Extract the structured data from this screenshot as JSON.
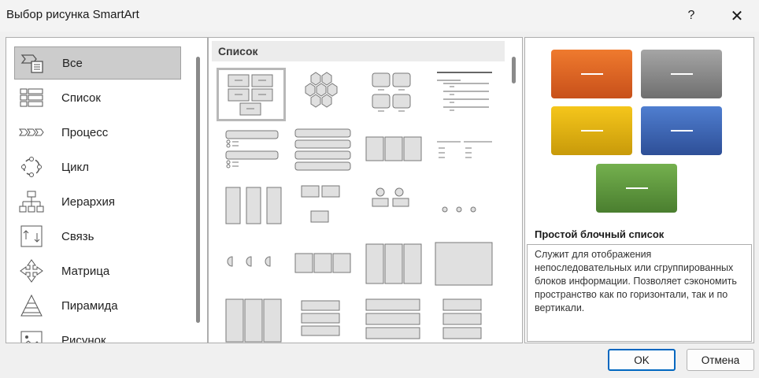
{
  "window": {
    "title": "Выбор рисунка SmartArt",
    "help": "?",
    "close": "✕"
  },
  "categories": [
    {
      "label": "Все",
      "icon": "all-icon",
      "selected": true
    },
    {
      "label": "Список",
      "icon": "list-icon"
    },
    {
      "label": "Процесс",
      "icon": "process-icon"
    },
    {
      "label": "Цикл",
      "icon": "cycle-icon"
    },
    {
      "label": "Иерархия",
      "icon": "hierarchy-icon"
    },
    {
      "label": "Связь",
      "icon": "relationship-icon"
    },
    {
      "label": "Матрица",
      "icon": "matrix-icon"
    },
    {
      "label": "Пирамида",
      "icon": "pyramid-icon"
    },
    {
      "label": "Рисунок",
      "icon": "picture-icon"
    }
  ],
  "gallery": {
    "header": "Список",
    "selected_index": 0
  },
  "preview": {
    "title": "Простой блочный список",
    "description": "Служит для отображения непоследовательных или сгруппированных блоков информации. Позволяет сэкономить пространство как по горизонтали, так и по вертикали.",
    "block_colors": [
      "#e06a1f",
      "#8c8c8c",
      "#e8b40a",
      "#3d67b8",
      "#5f9e3f"
    ]
  },
  "buttons": {
    "ok": "OK",
    "cancel": "Отмена"
  }
}
